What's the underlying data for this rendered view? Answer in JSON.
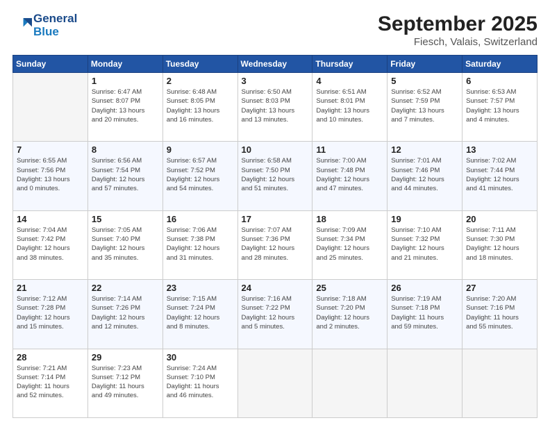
{
  "header": {
    "logo_line1": "General",
    "logo_line2": "Blue",
    "title": "September 2025",
    "subtitle": "Fiesch, Valais, Switzerland"
  },
  "days_of_week": [
    "Sunday",
    "Monday",
    "Tuesday",
    "Wednesday",
    "Thursday",
    "Friday",
    "Saturday"
  ],
  "weeks": [
    [
      {
        "day": "",
        "info": ""
      },
      {
        "day": "1",
        "info": "Sunrise: 6:47 AM\nSunset: 8:07 PM\nDaylight: 13 hours\nand 20 minutes."
      },
      {
        "day": "2",
        "info": "Sunrise: 6:48 AM\nSunset: 8:05 PM\nDaylight: 13 hours\nand 16 minutes."
      },
      {
        "day": "3",
        "info": "Sunrise: 6:50 AM\nSunset: 8:03 PM\nDaylight: 13 hours\nand 13 minutes."
      },
      {
        "day": "4",
        "info": "Sunrise: 6:51 AM\nSunset: 8:01 PM\nDaylight: 13 hours\nand 10 minutes."
      },
      {
        "day": "5",
        "info": "Sunrise: 6:52 AM\nSunset: 7:59 PM\nDaylight: 13 hours\nand 7 minutes."
      },
      {
        "day": "6",
        "info": "Sunrise: 6:53 AM\nSunset: 7:57 PM\nDaylight: 13 hours\nand 4 minutes."
      }
    ],
    [
      {
        "day": "7",
        "info": "Sunrise: 6:55 AM\nSunset: 7:56 PM\nDaylight: 13 hours\nand 0 minutes."
      },
      {
        "day": "8",
        "info": "Sunrise: 6:56 AM\nSunset: 7:54 PM\nDaylight: 12 hours\nand 57 minutes."
      },
      {
        "day": "9",
        "info": "Sunrise: 6:57 AM\nSunset: 7:52 PM\nDaylight: 12 hours\nand 54 minutes."
      },
      {
        "day": "10",
        "info": "Sunrise: 6:58 AM\nSunset: 7:50 PM\nDaylight: 12 hours\nand 51 minutes."
      },
      {
        "day": "11",
        "info": "Sunrise: 7:00 AM\nSunset: 7:48 PM\nDaylight: 12 hours\nand 47 minutes."
      },
      {
        "day": "12",
        "info": "Sunrise: 7:01 AM\nSunset: 7:46 PM\nDaylight: 12 hours\nand 44 minutes."
      },
      {
        "day": "13",
        "info": "Sunrise: 7:02 AM\nSunset: 7:44 PM\nDaylight: 12 hours\nand 41 minutes."
      }
    ],
    [
      {
        "day": "14",
        "info": "Sunrise: 7:04 AM\nSunset: 7:42 PM\nDaylight: 12 hours\nand 38 minutes."
      },
      {
        "day": "15",
        "info": "Sunrise: 7:05 AM\nSunset: 7:40 PM\nDaylight: 12 hours\nand 35 minutes."
      },
      {
        "day": "16",
        "info": "Sunrise: 7:06 AM\nSunset: 7:38 PM\nDaylight: 12 hours\nand 31 minutes."
      },
      {
        "day": "17",
        "info": "Sunrise: 7:07 AM\nSunset: 7:36 PM\nDaylight: 12 hours\nand 28 minutes."
      },
      {
        "day": "18",
        "info": "Sunrise: 7:09 AM\nSunset: 7:34 PM\nDaylight: 12 hours\nand 25 minutes."
      },
      {
        "day": "19",
        "info": "Sunrise: 7:10 AM\nSunset: 7:32 PM\nDaylight: 12 hours\nand 21 minutes."
      },
      {
        "day": "20",
        "info": "Sunrise: 7:11 AM\nSunset: 7:30 PM\nDaylight: 12 hours\nand 18 minutes."
      }
    ],
    [
      {
        "day": "21",
        "info": "Sunrise: 7:12 AM\nSunset: 7:28 PM\nDaylight: 12 hours\nand 15 minutes."
      },
      {
        "day": "22",
        "info": "Sunrise: 7:14 AM\nSunset: 7:26 PM\nDaylight: 12 hours\nand 12 minutes."
      },
      {
        "day": "23",
        "info": "Sunrise: 7:15 AM\nSunset: 7:24 PM\nDaylight: 12 hours\nand 8 minutes."
      },
      {
        "day": "24",
        "info": "Sunrise: 7:16 AM\nSunset: 7:22 PM\nDaylight: 12 hours\nand 5 minutes."
      },
      {
        "day": "25",
        "info": "Sunrise: 7:18 AM\nSunset: 7:20 PM\nDaylight: 12 hours\nand 2 minutes."
      },
      {
        "day": "26",
        "info": "Sunrise: 7:19 AM\nSunset: 7:18 PM\nDaylight: 11 hours\nand 59 minutes."
      },
      {
        "day": "27",
        "info": "Sunrise: 7:20 AM\nSunset: 7:16 PM\nDaylight: 11 hours\nand 55 minutes."
      }
    ],
    [
      {
        "day": "28",
        "info": "Sunrise: 7:21 AM\nSunset: 7:14 PM\nDaylight: 11 hours\nand 52 minutes."
      },
      {
        "day": "29",
        "info": "Sunrise: 7:23 AM\nSunset: 7:12 PM\nDaylight: 11 hours\nand 49 minutes."
      },
      {
        "day": "30",
        "info": "Sunrise: 7:24 AM\nSunset: 7:10 PM\nDaylight: 11 hours\nand 46 minutes."
      },
      {
        "day": "",
        "info": ""
      },
      {
        "day": "",
        "info": ""
      },
      {
        "day": "",
        "info": ""
      },
      {
        "day": "",
        "info": ""
      }
    ]
  ]
}
